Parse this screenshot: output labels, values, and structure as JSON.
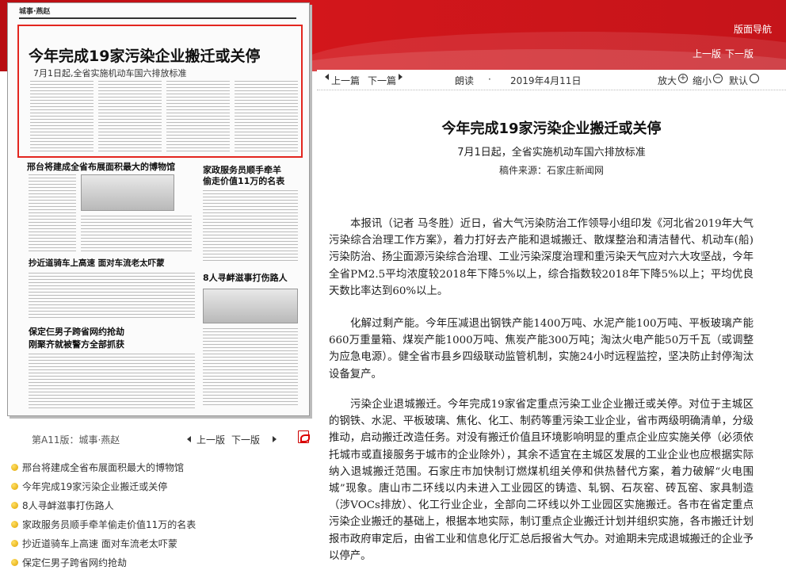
{
  "nav": {
    "main": "版面导航",
    "prev": "上一版",
    "next": "下一版"
  },
  "paper": {
    "masthead": "城事·燕赵",
    "headline": "今年完成19家污染企业搬迁或关停",
    "headline_sub": "7月1日起,全省实施机动车国六排放标准",
    "sections": [
      {
        "title": "邢台将建成全省布展面积最大的博物馆"
      },
      {
        "title": "家政服务员顺手牵羊"
      },
      {
        "title": "偷走价值11万的名表"
      },
      {
        "title": "抄近道骑车上高速 面对车流老太吓蒙"
      },
      {
        "title": "8人寻衅滋事打伤路人"
      },
      {
        "title": "保定仨男子跨省网约抢劫"
      },
      {
        "title": "刚聚齐就被警方全部抓获"
      }
    ]
  },
  "pagebar": {
    "label": "第A11版：城事·燕赵",
    "prev": "上一版",
    "next": "下一版"
  },
  "article_list": [
    "邢台将建成全省布展面积最大的博物馆",
    "今年完成19家污染企业搬迁或关停",
    "8人寻衅滋事打伤路人",
    "家政服务员顺手牵羊偷走价值11万的名表",
    "抄近道骑车上高速 面对车流老太吓蒙",
    "保定仨男子跨省网约抢劫"
  ],
  "toolbar": {
    "prev_article": "上一篇",
    "next_article": "下一篇",
    "read_aloud": "朗读",
    "date": "2019年4月11日",
    "zoom_in": "放大",
    "zoom_out": "缩小",
    "default": "默认"
  },
  "article": {
    "title": "今年完成19家污染企业搬迁或关停",
    "subtitle": "7月1日起，全省实施机动车国六排放标准",
    "source": "稿件来源：石家庄新闻网",
    "paragraphs": [
      "本报讯（记者 马冬胜）近日，省大气污染防治工作领导小组印发《河北省2019年大气污染综合治理工作方案》，着力打好去产能和退城搬迁、散煤整治和清洁替代、机动车(船)污染防治、扬尘面源污染综合治理、工业污染深度治理和重污染天气应对六大攻坚战，今年全省PM2.5平均浓度较2018年下降5%以上，综合指数较2018年下降5%以上；平均优良天数比率达到60%以上。",
      "化解过剩产能。今年压减退出钢铁产能1400万吨、水泥产能100万吨、平板玻璃产能660万重量箱、煤炭产能1000万吨、焦炭产能300万吨；淘汰火电产能50万千瓦（或调整为应急电源）。健全省市县乡四级联动监管机制，实施24小时远程监控，坚决防止封停淘汰设备复产。",
      "污染企业退城搬迁。今年完成19家省定重点污染工业企业搬迁或关停。对位于主城区的钢铁、水泥、平板玻璃、焦化、化工、制药等重污染工业企业，省市两级明确清单，分级推动，启动搬迁改造任务。对没有搬迁价值且环境影响明显的重点企业应实施关停（必须依托城市或直接服务于城市的企业除外），其余不适宜在主城区发展的工业企业也应根据实际纳入退城搬迁范围。石家庄市加快制订燃煤机组关停和供热替代方案，着力破解“火电围城”现象。唐山市二环线以内未进入工业园区的铸造、轧钢、石灰窑、砖瓦窑、家具制造（涉VOCs排放）、化工行业企业，全部向二环线以外工业园区实施搬迁。各市在省定重点污染企业搬迁的基础上，根据本地实际，制订重点企业搬迁计划并组织实施，各市搬迁计划报市政府审定后，由省工业和信息化厅汇总后报省大气办。对逾期未完成退城搬迁的企业予以停产。"
    ]
  }
}
